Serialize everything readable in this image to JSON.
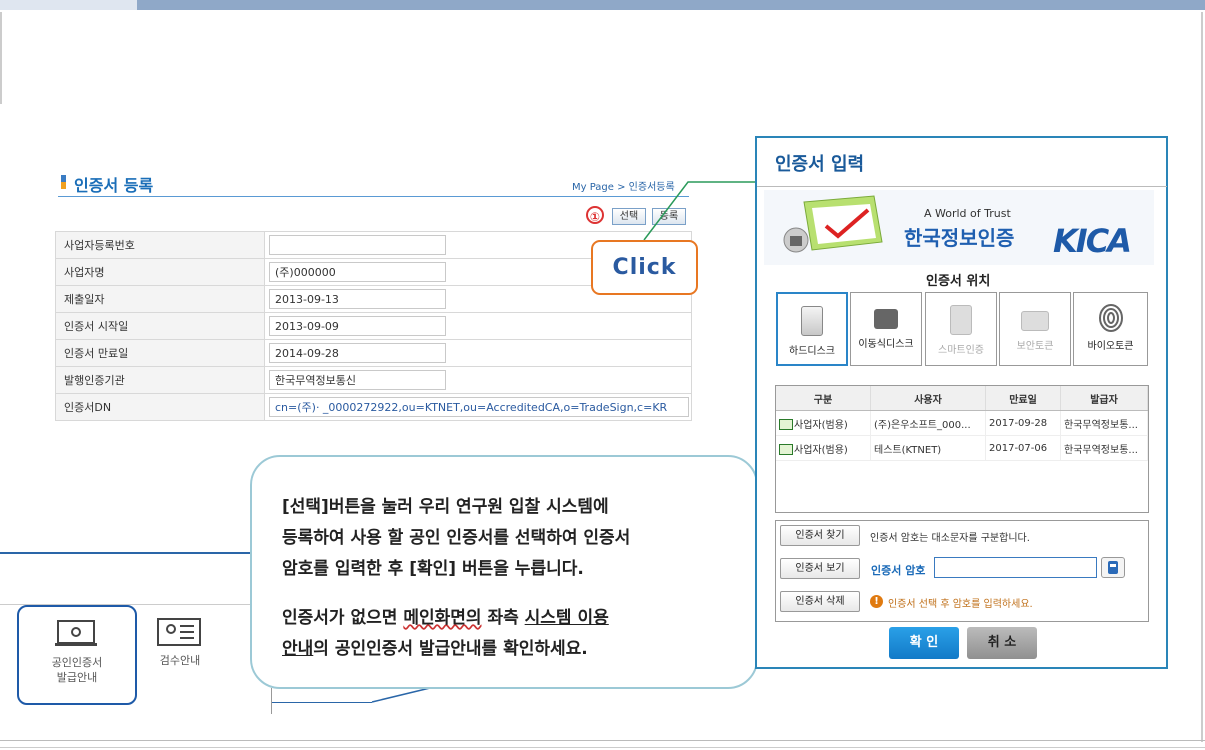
{
  "page": {
    "title": "인증서 등록",
    "breadcrumb": "My Page > 인증서등록",
    "marker": "①",
    "select_button": "선택",
    "register_button": "등록",
    "click_label": "Click",
    "form": [
      {
        "label": "사업자등록번호",
        "value": ""
      },
      {
        "label": "사업자명",
        "value": "(주)000000"
      },
      {
        "label": "제출일자",
        "value": "2013-09-13"
      },
      {
        "label": "인증서 시작일",
        "value": "2013-09-09"
      },
      {
        "label": "인증서 만료일",
        "value": "2014-09-28"
      },
      {
        "label": "발행인증기관",
        "value": "한국무역정보통신"
      },
      {
        "label": "인증서DN",
        "value": "cn=(주)·                    _0000272922,ou=KTNET,ou=AccreditedCA,o=TradeSign,c=KR"
      }
    ],
    "tiles": {
      "tile1_line1": "공인인증서",
      "tile1_line2": "발급안내",
      "tile2": "검수안내"
    }
  },
  "callout": {
    "line1": "[선택]버튼을 눌러 우리 연구원 입찰 시스템에",
    "line2": "등록하여 사용 할 공인 인증서를 선택하여 인증서",
    "line3": "암호를 입력한 후 [확인] 버튼을 누릅니다.",
    "line4_a": "인증서가 없으면 ",
    "line4_b": "메인화면의",
    "line4_c": " 좌측 ",
    "line4_d": "시스템 이용",
    "line5_a": "안내",
    "line5_b": "의 공인인증서 발급안내를 확인하세요."
  },
  "dialog": {
    "title": "인증서 입력",
    "banner_small": "A World of Trust",
    "banner_big": "한국정보인증",
    "banner_logo": "KICA",
    "location_title": "인증서 위치",
    "locations": [
      {
        "label": "하드디스크",
        "icon": "hard-disk-icon"
      },
      {
        "label": "이동식디스크",
        "icon": "usb-drive-icon"
      },
      {
        "label": "스마트인증",
        "icon": "smartphone-icon"
      },
      {
        "label": "보안토큰",
        "icon": "security-token-icon"
      },
      {
        "label": "바이오토큰",
        "icon": "fingerprint-icon"
      }
    ],
    "table_headers": [
      "구분",
      "사용자",
      "만료일",
      "발급자"
    ],
    "rows": [
      [
        "사업자(범용)",
        "(주)은우소프트_000...",
        "2017-09-28",
        "한국무역정보통..."
      ],
      [
        "사업자(범용)",
        "테스트(KTNET)",
        "2017-07-06",
        "한국무역정보통..."
      ]
    ],
    "find_button": "인증서 찾기",
    "view_button": "인증서 보기",
    "delete_button": "인증서 삭제",
    "case_note": "인증서 암호는 대소문자를 구분합니다.",
    "password_label": "인증서 암호",
    "warning": "인증서 선택 후 암호를 입력하세요.",
    "ok_button": "확 인",
    "cancel_button": "취 소"
  }
}
